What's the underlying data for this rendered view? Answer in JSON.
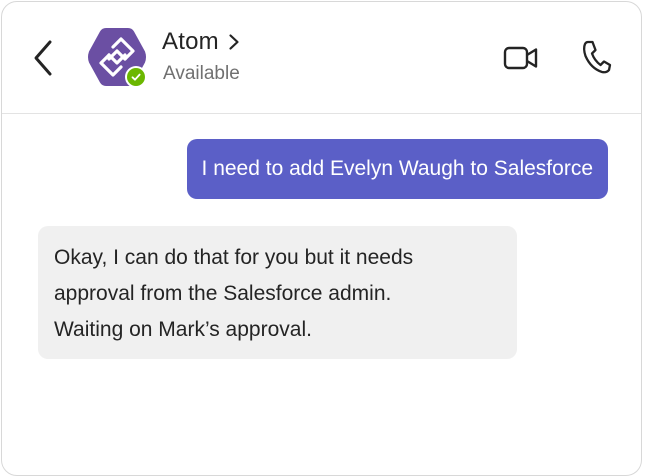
{
  "header": {
    "contact_name": "Atom",
    "status": "Available"
  },
  "icons": {
    "back": "chevron-left-icon",
    "avatar": "atom-logo-icon",
    "presence": "available-check-icon",
    "name_chevron": "chevron-right-icon",
    "video": "video-camera-icon",
    "call": "phone-icon"
  },
  "messages": [
    {
      "direction": "outgoing",
      "lines": [
        "I need to add Evelyn Waugh to Salesforce"
      ]
    },
    {
      "direction": "incoming",
      "lines": [
        "Okay, I can do that for you but it needs",
        "approval from the Salesforce admin.",
        "Waiting on Mark’s approval."
      ]
    }
  ],
  "colors": {
    "accent": "#5b5fc7",
    "avatar": "#6b4fa3",
    "presence_available": "#6bb700",
    "incoming_bubble": "#f0f0f0",
    "text_primary": "#242424",
    "text_secondary": "#707070"
  }
}
